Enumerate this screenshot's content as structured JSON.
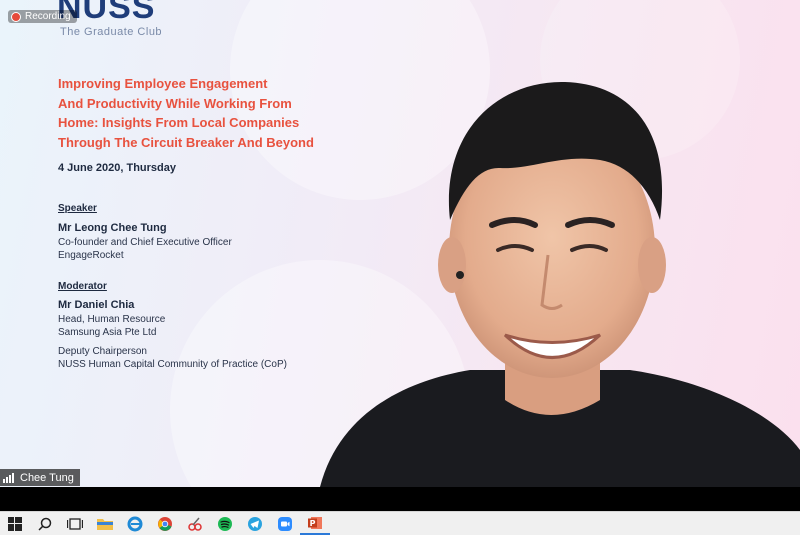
{
  "recording": {
    "label": "Recording"
  },
  "slide": {
    "logo": "NUSS",
    "logo_sub": "The Graduate Club",
    "title_lines": [
      "Improving Employee Engagement",
      "And Productivity While Working From",
      "Home: Insights From Local Companies",
      "Through The Circuit Breaker And Beyond"
    ],
    "date": "4 June 2020, Thursday",
    "speaker": {
      "heading": "Speaker",
      "name": "Mr Leong Chee Tung",
      "lines": [
        "Co-founder and Chief Executive Officer",
        "EngageRocket"
      ]
    },
    "moderator": {
      "heading": "Moderator",
      "name": "Mr Daniel Chia",
      "lines": [
        "Head, Human Resource",
        "Samsung Asia Pte Ltd",
        "Deputy Chairperson",
        "NUSS Human Capital Community of Practice (CoP)"
      ]
    }
  },
  "participant": {
    "name": "Chee Tung"
  },
  "taskbar": {
    "items": [
      "windows-start",
      "search",
      "task-view",
      "file-explorer",
      "internet-explorer",
      "chrome",
      "snipping-tool",
      "spotify",
      "telegram",
      "zoom",
      "powerpoint"
    ]
  },
  "colors": {
    "title": "#e8523f",
    "logo": "#1f3d7a",
    "text": "#1e2a40"
  }
}
